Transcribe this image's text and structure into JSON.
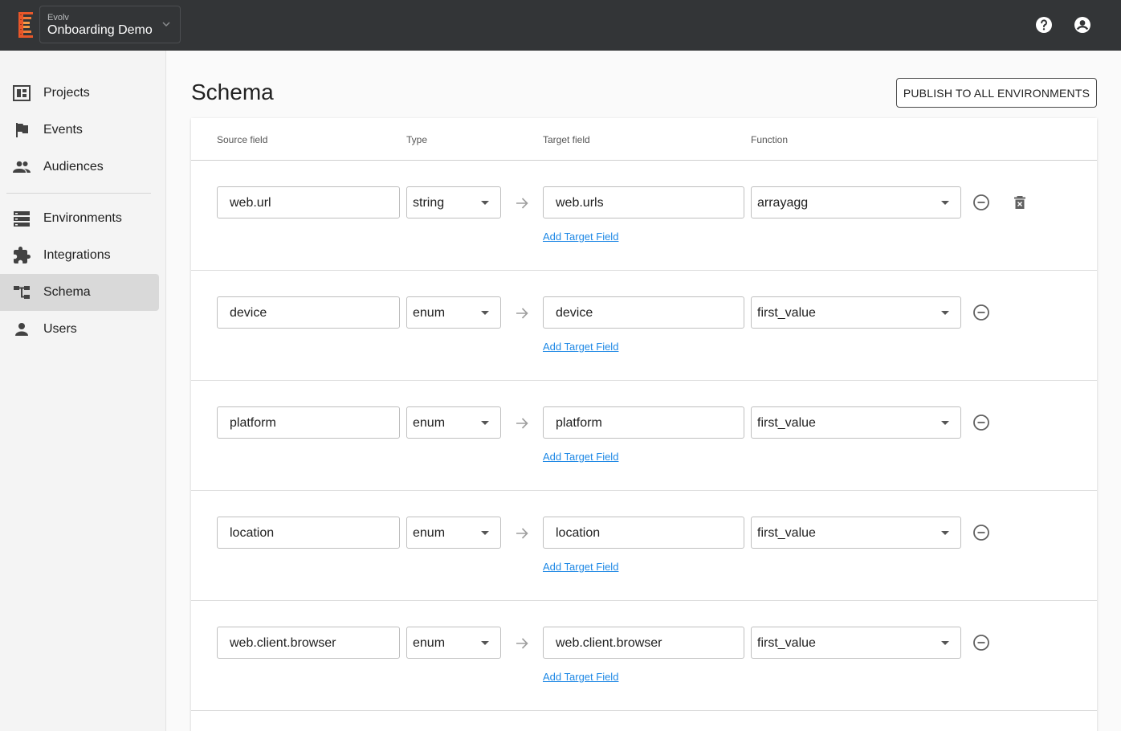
{
  "header": {
    "org_label": "Evolv",
    "org_name": "Onboarding Demo",
    "help_icon": "help-circle-icon",
    "account_icon": "account-circle-icon"
  },
  "sidebar": {
    "items": [
      {
        "label": "Projects",
        "icon": "dashboard-icon",
        "active": false
      },
      {
        "label": "Events",
        "icon": "flag-icon",
        "active": false
      },
      {
        "label": "Audiences",
        "icon": "people-icon",
        "active": false
      },
      {
        "label": "Environments",
        "icon": "storage-icon",
        "active": false
      },
      {
        "label": "Integrations",
        "icon": "puzzle-icon",
        "active": false
      },
      {
        "label": "Schema",
        "icon": "schema-tree-icon",
        "active": true
      },
      {
        "label": "Users",
        "icon": "person-icon",
        "active": false
      }
    ]
  },
  "main": {
    "title": "Schema",
    "publish_label": "PUBLISH TO ALL ENVIRONMENTS",
    "columns": {
      "source": "Source field",
      "type": "Type",
      "target": "Target field",
      "function": "Function"
    },
    "add_target_label": "Add Target Field",
    "rows": [
      {
        "source": "web.url",
        "type": "string",
        "target": "web.urls",
        "function": "arrayagg",
        "deletable": true
      },
      {
        "source": "device",
        "type": "enum",
        "target": "device",
        "function": "first_value",
        "deletable": false
      },
      {
        "source": "platform",
        "type": "enum",
        "target": "platform",
        "function": "first_value",
        "deletable": false
      },
      {
        "source": "location",
        "type": "enum",
        "target": "location",
        "function": "first_value",
        "deletable": false
      },
      {
        "source": "web.client.browser",
        "type": "enum",
        "target": "web.client.browser",
        "function": "first_value",
        "deletable": false
      }
    ]
  },
  "colors": {
    "topbar": "#333537",
    "link": "#1e88e5",
    "logo_orange": "#e8572a"
  }
}
